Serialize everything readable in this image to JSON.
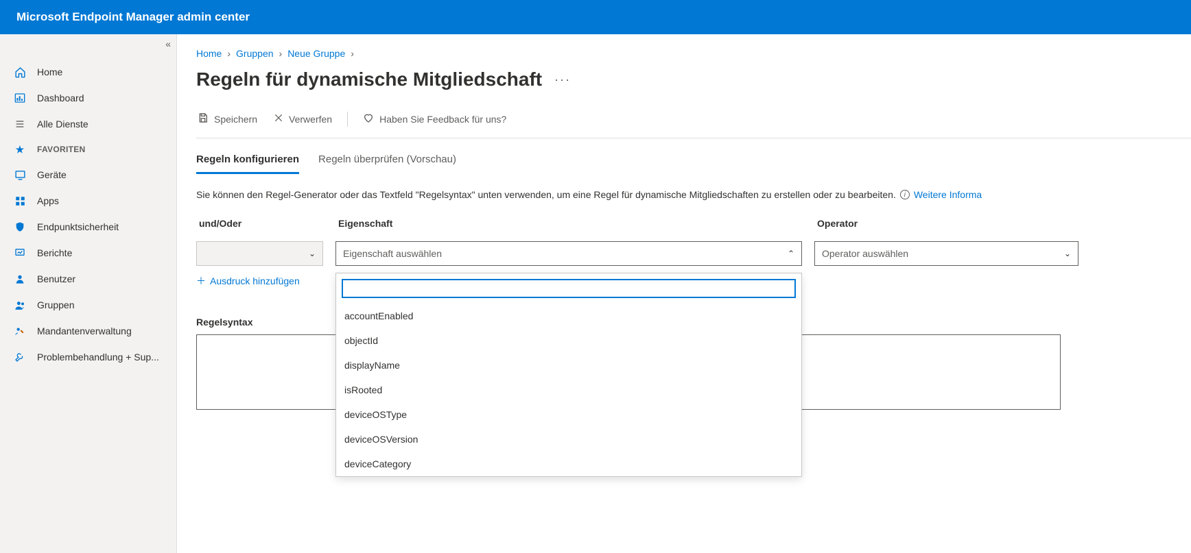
{
  "topbar": {
    "title": "Microsoft Endpoint Manager admin center"
  },
  "sidebar": {
    "items0": [
      {
        "label": "Home"
      },
      {
        "label": "Dashboard"
      },
      {
        "label": "Alle Dienste"
      }
    ],
    "favHeader": "FAVORITEN",
    "items1": [
      {
        "label": "Geräte"
      },
      {
        "label": "Apps"
      },
      {
        "label": "Endpunktsicherheit"
      },
      {
        "label": "Berichte"
      },
      {
        "label": "Benutzer"
      },
      {
        "label": "Gruppen"
      },
      {
        "label": "Mandantenverwaltung"
      },
      {
        "label": "Problembehandlung + Sup..."
      }
    ]
  },
  "breadcrumb": {
    "a": "Home",
    "b": "Gruppen",
    "c": "Neue Gruppe"
  },
  "page": {
    "title": "Regeln für dynamische Mitgliedschaft"
  },
  "toolbar": {
    "save": "Speichern",
    "discard": "Verwerfen",
    "feedback": "Haben Sie Feedback für uns?"
  },
  "tabs": {
    "t0": "Regeln konfigurieren",
    "t1": "Regeln überprüfen (Vorschau)"
  },
  "hint": {
    "text": "Sie können den Regel-Generator oder das Textfeld \"Regelsyntax\" unten verwenden, um eine Regel für dynamische Mitgliedschaften zu erstellen oder zu bearbeiten.",
    "link": "Weitere Informa"
  },
  "columns": {
    "andor": "und/Oder",
    "prop": "Eigenschaft",
    "op": "Operator"
  },
  "selects": {
    "propPlaceholder": "Eigenschaft auswählen",
    "opPlaceholder": "Operator auswählen"
  },
  "dropdown": {
    "o0": "accountEnabled",
    "o1": "objectId",
    "o2": "displayName",
    "o3": "isRooted",
    "o4": "deviceOSType",
    "o5": "deviceOSVersion",
    "o6": "deviceCategory"
  },
  "addExpr": "Ausdruck hinzufügen",
  "syntaxLabel": "Regelsyntax"
}
